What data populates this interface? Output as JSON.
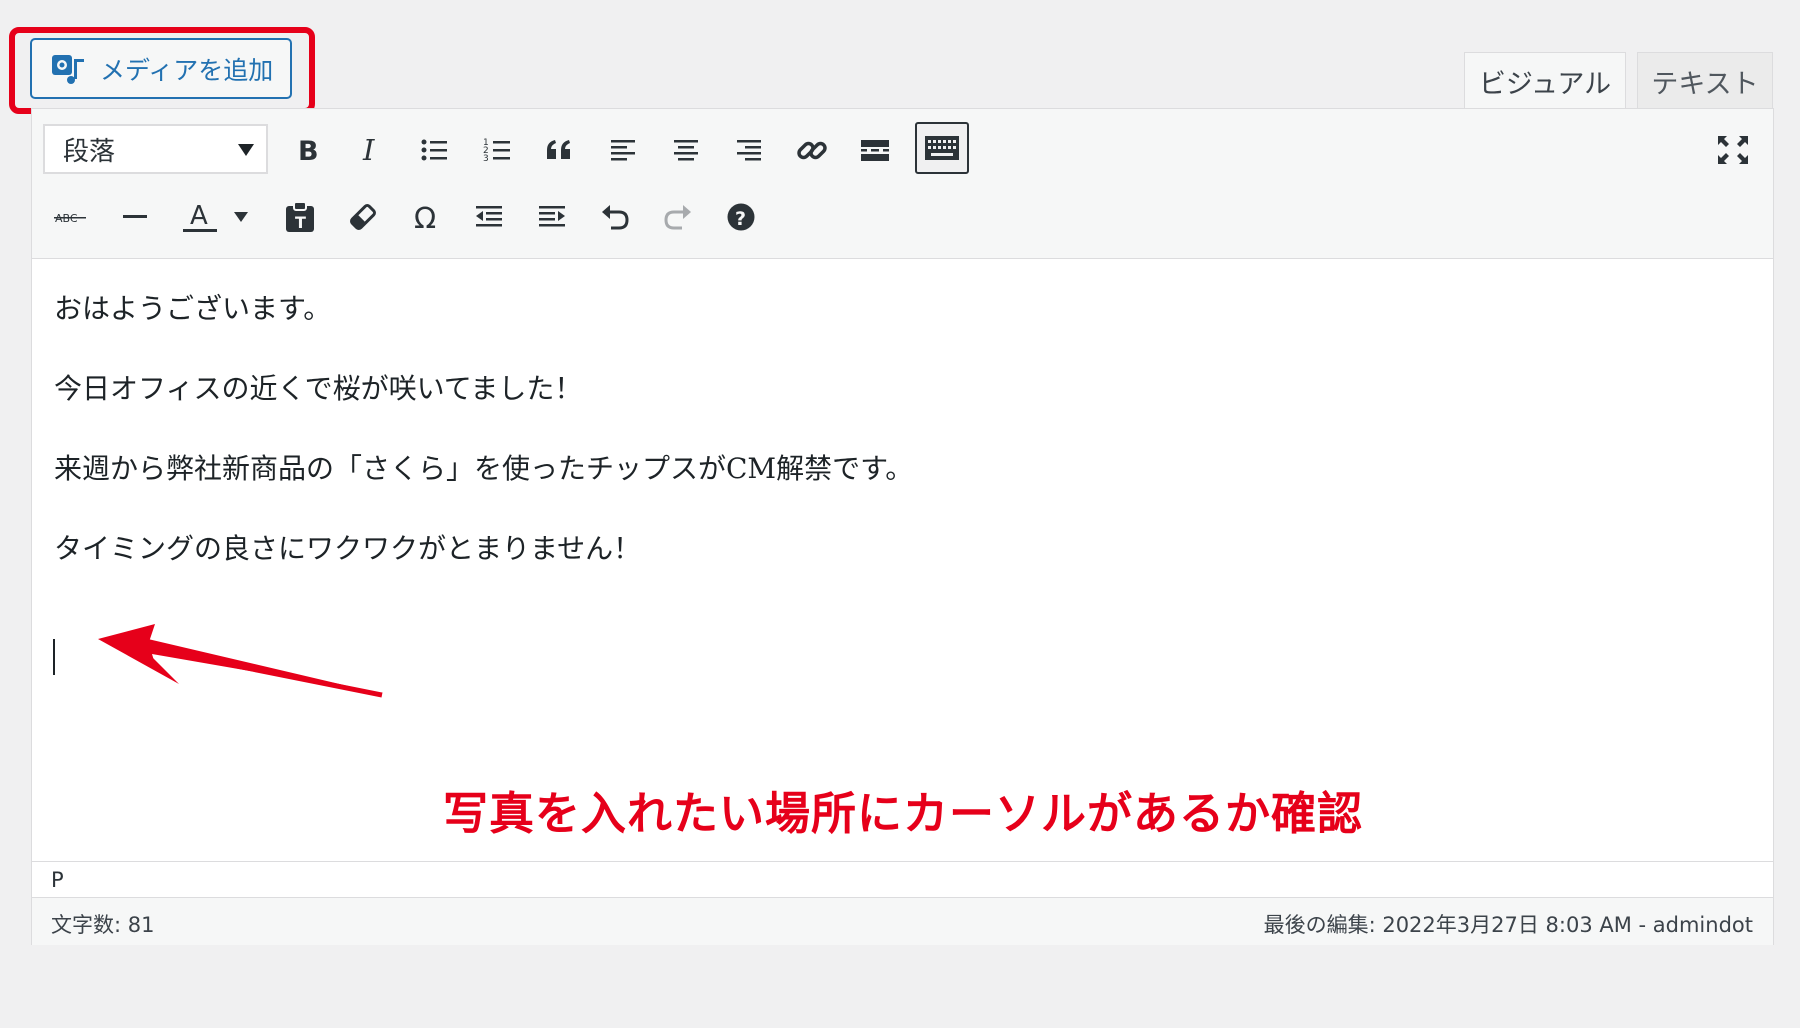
{
  "media_button": {
    "label": "メディアを追加"
  },
  "tabs": {
    "visual": "ビジュアル",
    "text": "テキスト"
  },
  "toolbar": {
    "format_select": "段落"
  },
  "content": {
    "paragraphs": [
      "おはようございます。",
      "今日オフィスの近くで桜が咲いてました！",
      "来週から弊社新商品の「さくら」を使ったチップスがCM解禁です。",
      "タイミングの良さにワクワクがとまりません！"
    ]
  },
  "annotation": {
    "text": "写真を入れたい場所にカーソルがあるか確認",
    "color": "#e6001a"
  },
  "path_bar": {
    "element": "P"
  },
  "status": {
    "word_count": "文字数: 81",
    "last_edit": "最後の編集: 2022年3月27日 8:03 AM - admindot"
  },
  "colors": {
    "accent": "#2271b1",
    "highlight": "#e6001a"
  }
}
